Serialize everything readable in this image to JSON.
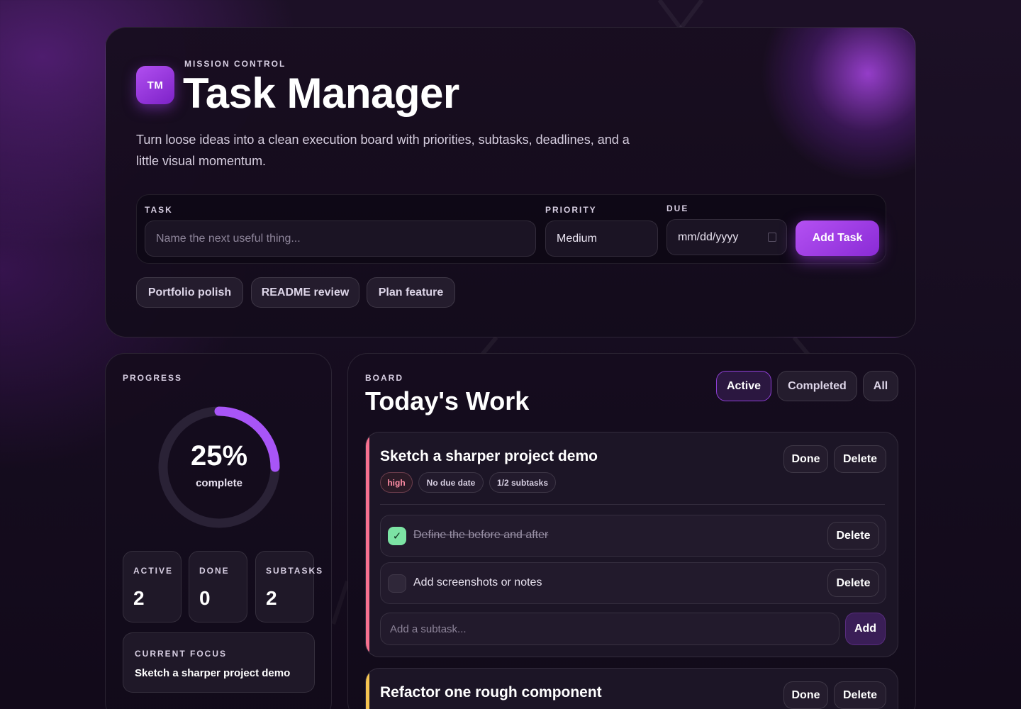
{
  "hero": {
    "logo": "TM",
    "eyebrow": "MISSION CONTROL",
    "title": "Task Manager",
    "subtitle": "Turn loose ideas into a clean execution board with priorities, subtasks, deadlines, and a little visual momentum."
  },
  "form": {
    "task_label": "TASK",
    "task_placeholder": "Name the next useful thing...",
    "priority_label": "PRIORITY",
    "priority_value": "Medium",
    "due_label": "DUE",
    "due_placeholder": "mm/dd/yyyy",
    "add_label": "Add Task"
  },
  "quick_chips": [
    "Portfolio polish",
    "README review",
    "Plan feature"
  ],
  "progress": {
    "eyebrow": "PROGRESS",
    "percent": 25,
    "percent_text": "25%",
    "percent_label": "complete",
    "accent": "#a855f7",
    "stats": [
      {
        "label": "ACTIVE",
        "value": "2"
      },
      {
        "label": "DONE",
        "value": "0"
      },
      {
        "label": "SUBTASKS",
        "value": "2"
      }
    ],
    "focus_label": "CURRENT FOCUS",
    "focus_value": "Sketch a sharper project demo"
  },
  "board": {
    "eyebrow": "BOARD",
    "title": "Today's Work",
    "filters": [
      "Active",
      "Completed",
      "All"
    ],
    "active_filter": "Active",
    "tasks": [
      {
        "title": "Sketch a sharper project demo",
        "priority": "high",
        "priority_color": "#f87190",
        "due": "No due date",
        "subtask_count": "1/2 subtasks",
        "done_label": "Done",
        "delete_label": "Delete",
        "subtasks": [
          {
            "text": "Define the before and after",
            "done": true,
            "delete_label": "Delete"
          },
          {
            "text": "Add screenshots or notes",
            "done": false,
            "delete_label": "Delete"
          }
        ],
        "subtask_placeholder": "Add a subtask...",
        "subtask_add_label": "Add"
      },
      {
        "title": "Refactor one rough component",
        "priority_color": "#f5c451",
        "done_label": "Done",
        "delete_label": "Delete"
      }
    ]
  }
}
